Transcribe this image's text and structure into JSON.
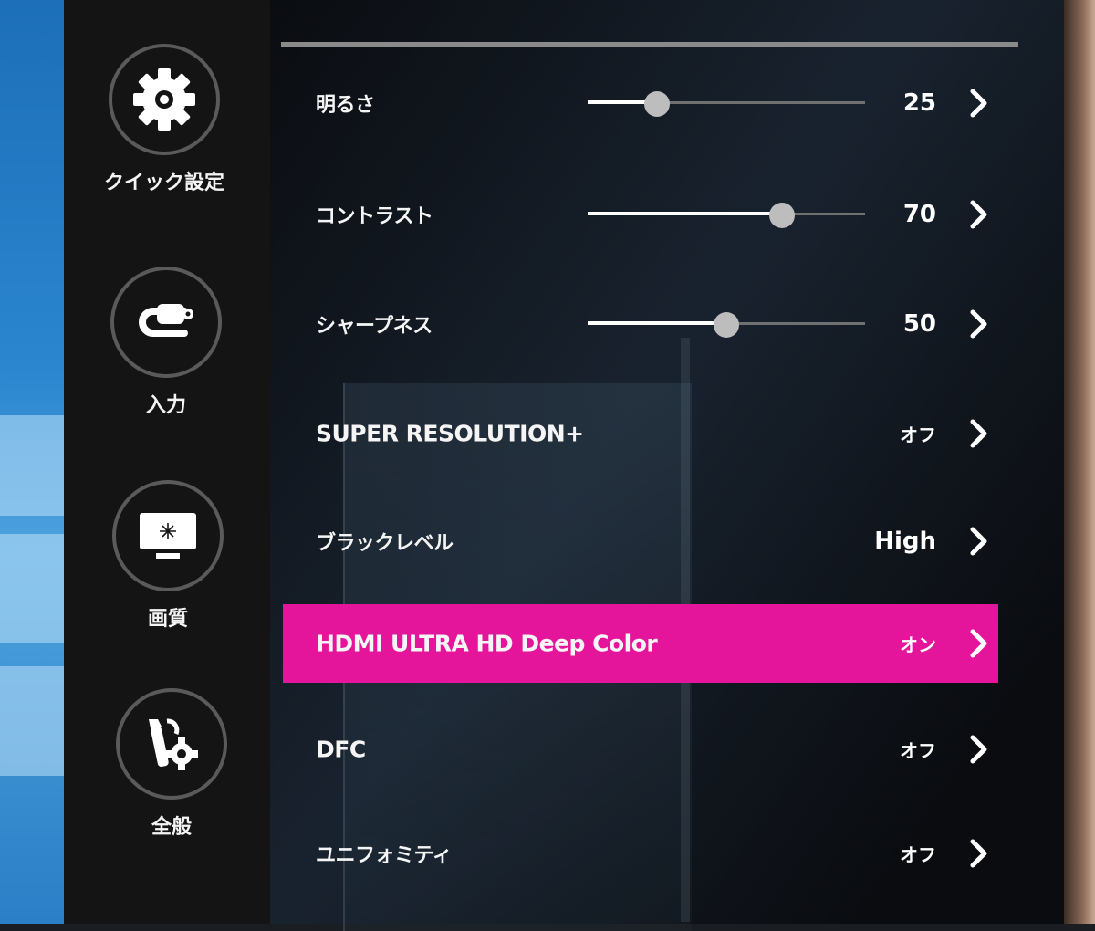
{
  "sidebar": {
    "items": [
      {
        "label": "クイック設定",
        "icon": "gear-icon",
        "active": false
      },
      {
        "label": "入力",
        "icon": "input-plug-icon",
        "active": false
      },
      {
        "label": "画質",
        "icon": "picture-monitor-icon",
        "active": true
      },
      {
        "label": "全般",
        "icon": "wrench-gear-icon",
        "active": false
      }
    ]
  },
  "menu": {
    "rows": [
      {
        "label": "明るさ",
        "type": "slider",
        "value": "25",
        "level": 25
      },
      {
        "label": "コントラスト",
        "type": "slider",
        "value": "70",
        "level": 70
      },
      {
        "label": "シャープネス",
        "type": "slider",
        "value": "50",
        "level": 50
      },
      {
        "label": "SUPER RESOLUTION+",
        "type": "option",
        "value": "オフ"
      },
      {
        "label": "ブラックレベル",
        "type": "option",
        "value": "High"
      },
      {
        "label": "HDMI ULTRA HD Deep Color",
        "type": "option",
        "value": "オン",
        "selected": true
      },
      {
        "label": "DFC",
        "type": "option",
        "value": "オフ"
      },
      {
        "label": "ユニフォミティ",
        "type": "option",
        "value": "オフ"
      }
    ]
  },
  "colors": {
    "accent": "#e4159a",
    "active_ring": "#e2187f",
    "panel": "#141414"
  },
  "icons": {
    "row_arrow": "chevron-right-icon"
  }
}
